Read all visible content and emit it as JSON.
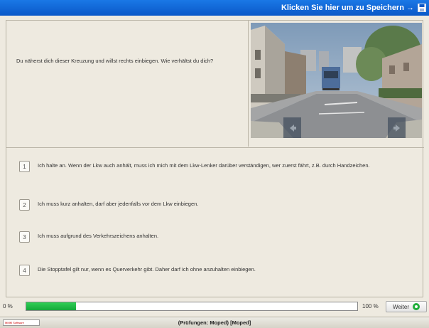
{
  "header": {
    "save_label": "Klicken Sie hier um zu Speichern →",
    "save_icon": "floppy-disk-icon"
  },
  "question": {
    "text": "Du näherst dich dieser Kreuzung und willst rechts einbiegen. Wie verhältst du dich?"
  },
  "photo": {
    "description_icon": "street-photo",
    "prev_icon": "arrow-left-icon",
    "next_icon": "arrow-right-icon"
  },
  "answers": [
    {
      "number": "1",
      "text": "Ich halte an. Wenn der Lkw auch anhält, muss ich mich mit dem Lkw-Lenker darüber verständigen, wer zuerst fährt, z.B. durch Handzeichen."
    },
    {
      "number": "2",
      "text": "Ich muss kurz anhalten, darf aber jedenfalls vor dem Lkw einbiegen."
    },
    {
      "number": "3",
      "text": "Ich muss aufgrund des Verkehrszeichens anhalten."
    },
    {
      "number": "4",
      "text": "Die Stopptafel gilt nur, wenn es Querverkehr gibt. Daher darf ich ohne anzuhalten einbiegen."
    }
  ],
  "progress": {
    "left_label": "0 %",
    "right_label": "100 %",
    "value": 0.15,
    "fill_color": "#22c04a"
  },
  "next_button": {
    "label": "Weiter",
    "icon": "green-circle-arrow-icon"
  },
  "status": {
    "logo_text": "MMM Software",
    "text": "(Prüfungen: Moped) [Moped]"
  },
  "colors": {
    "topbar": "#1a6fe0",
    "panel_bg": "#eeeae0",
    "accent_green": "#1fae3a"
  }
}
